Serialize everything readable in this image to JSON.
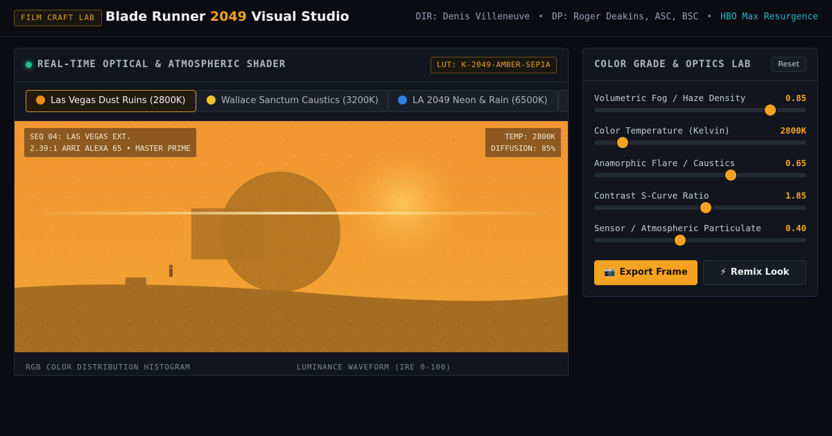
{
  "header": {
    "badge": "FILM CRAFT LAB",
    "title_pre": "Blade Runner",
    "title_accent": "2049",
    "title_post": "Visual Studio",
    "director": "DIR: Denis Villeneuve",
    "dp": "DP: Roger Deakins, ASC, BSC",
    "platform": "HBO Max Resurgence"
  },
  "shader": {
    "title": "REAL-TIME OPTICAL & ATMOSPHERIC SHADER",
    "lut": "LUT: K-2049-AMBER-SEPIA",
    "tabs": [
      {
        "label": "Las Vegas Dust Ruins (2800K)",
        "icon": "orange-circle-icon",
        "color": "#f08a1c",
        "active": true
      },
      {
        "label": "Wallace Sanctum Caustics (3200K)",
        "icon": "yellow-circle-icon",
        "color": "#f4c430",
        "active": false
      },
      {
        "label": "LA 2049 Neon & Rain (6500K)",
        "icon": "blue-circle-icon",
        "color": "#2f7fe0",
        "active": false
      },
      {
        "label": "",
        "icon": "",
        "color": "",
        "active": false
      }
    ],
    "overlay": {
      "seq": "SEQ 04: LAS VEGAS EXT.",
      "camera": "2.39:1 ARRI ALEXA 65 • MASTER PRIME",
      "temp": "TEMP: 2800K",
      "diffusion": "DIFFUSION: 85%"
    },
    "scopes": {
      "histogram": "RGB COLOR DISTRIBUTION HISTOGRAM",
      "waveform": "LUMINANCE WAVEFORM (IRE 0-100)"
    }
  },
  "grade": {
    "title": "COLOR GRADE & OPTICS LAB",
    "reset": "Reset",
    "sliders": [
      {
        "label": "Volumetric Fog / Haze Density",
        "value": "0.85",
        "fraction": 0.83
      },
      {
        "label": "Color Temperature (Kelvin)",
        "value": "2800K",
        "fraction": 0.135
      },
      {
        "label": "Anamorphic Flare / Caustics",
        "value": "0.65",
        "fraction": 0.645
      },
      {
        "label": "Contrast S-Curve Ratio",
        "value": "1.85",
        "fraction": 0.525
      },
      {
        "label": "Sensor / Atmospheric Particulate",
        "value": "0.40",
        "fraction": 0.405
      }
    ],
    "export_label": "Export Frame",
    "export_icon": "camera-icon",
    "remix_label": "Remix Look",
    "remix_icon": "lightning-icon"
  },
  "colors": {
    "accent": "#f4a221",
    "sky": "#f0982f",
    "ground": "#a66d22",
    "live": "#21c28b"
  }
}
